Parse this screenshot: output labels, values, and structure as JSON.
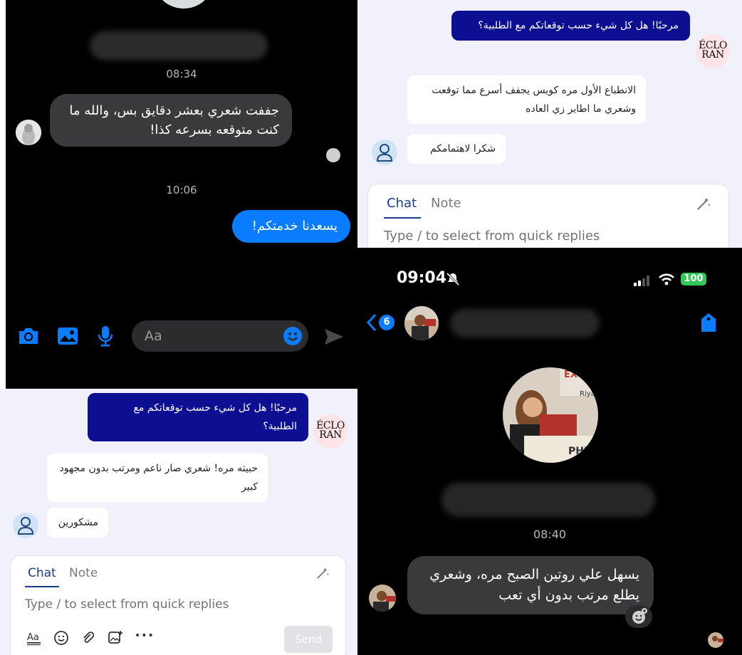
{
  "panel_a": {
    "timestamp_1": "08:34",
    "incoming_message": "جففت شعري بعشر دقايق بس، والله ما كنت متوقعه بسرعه كذا!",
    "timestamp_2": "10:06",
    "outgoing_message": "يسعدنا خدمتكم!",
    "composer_placeholder": "Aa"
  },
  "panel_b": {
    "greeting": "مرحبًا! هل كل شيء حسب توقعاتكم مع الطلبية؟",
    "brand_logo_text": "ÉCLO RAN",
    "reply_1": "الانطباع الأول مره كويس يجفف أسرع مما توقعت وشعري ما اطاير زي العاده",
    "reply_2": "شكرا لاهتمامكم",
    "tab_chat": "Chat",
    "tab_note": "Note",
    "placeholder": "Type / to select from quick replies"
  },
  "panel_c": {
    "greeting": "مرحبًا! هل كل شيء حسب توقعاتكم مع الطلبية؟",
    "brand_logo_text": "ÉCLO RAN",
    "reply_1": "حبيته مره! شعري صار ناعم ومرتب بدون مجهود كبير",
    "reply_2": "مشكورين",
    "tab_chat": "Chat",
    "tab_note": "Note",
    "placeholder": "Type / to select from quick replies",
    "send_label": "Send",
    "more_label": "•••"
  },
  "panel_d": {
    "status_time": "09:04",
    "battery": "100",
    "back_badge": "6",
    "timestamp": "08:40",
    "incoming_message": "يسهل علي روتين الصبح مره، وشعري يطلع مرتب بدون أي تعب"
  },
  "colors": {
    "messenger_blue": "#0a7cff",
    "navy_bubble": "#0c0f91",
    "dark_bubble": "#3a3a3c",
    "battery_green": "#34c759"
  }
}
